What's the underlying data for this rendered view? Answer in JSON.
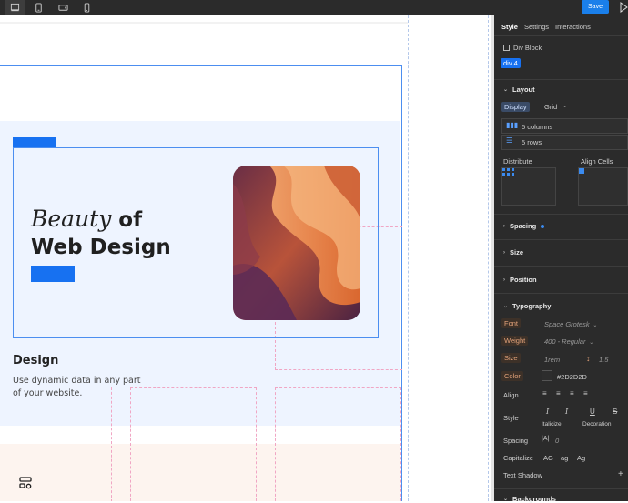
{
  "toolbar": {
    "devices": [
      "desktop-icon",
      "tablet-icon",
      "tablet-landscape-icon",
      "mobile-icon"
    ],
    "save_label": "Save"
  },
  "canvas": {
    "hero": {
      "title_italic": "Beauty",
      "title_bold": "of",
      "title_line2": "Web Design"
    },
    "design": {
      "heading": "Design",
      "text": "Use dynamic data in any part of your website."
    }
  },
  "panel": {
    "tabs": [
      {
        "label": "Style"
      },
      {
        "label": "Settings"
      },
      {
        "label": "Interactions"
      }
    ],
    "element_type": "Div Block",
    "selector": "div 4",
    "layout": {
      "heading": "Layout",
      "display_label": "Display",
      "display_value": "Grid",
      "columns": "5 columns",
      "rows": "5 rows",
      "distribute_label": "Distribute",
      "align_cells_label": "Align Cells"
    },
    "sections": {
      "spacing": "Spacing",
      "size": "Size",
      "position": "Position",
      "typography": "Typography",
      "backgrounds": "Backgrounds"
    },
    "typography": {
      "font_label": "Font",
      "font_value": "Space Grotesk",
      "weight_label": "Weight",
      "weight_value": "400 - Regular",
      "size_label": "Size",
      "size_value": "1rem",
      "line_height_value": "1.5",
      "color_label": "Color",
      "color_value": "#2D2D2D",
      "align_label": "Align",
      "style_label": "Style",
      "italicize_label": "Italicize",
      "decoration_label": "Decoration",
      "spacing_label": "Spacing",
      "spacing_value": "0",
      "capitalize_label": "Capitalize",
      "capitalize_options": [
        "AG",
        "ag",
        "Ag"
      ],
      "text_shadow_label": "Text Shadow"
    }
  },
  "colors": {
    "accent": "#1771F1",
    "panel_bg": "#2B2B2B",
    "highlight_orange": "#E4A37A"
  }
}
